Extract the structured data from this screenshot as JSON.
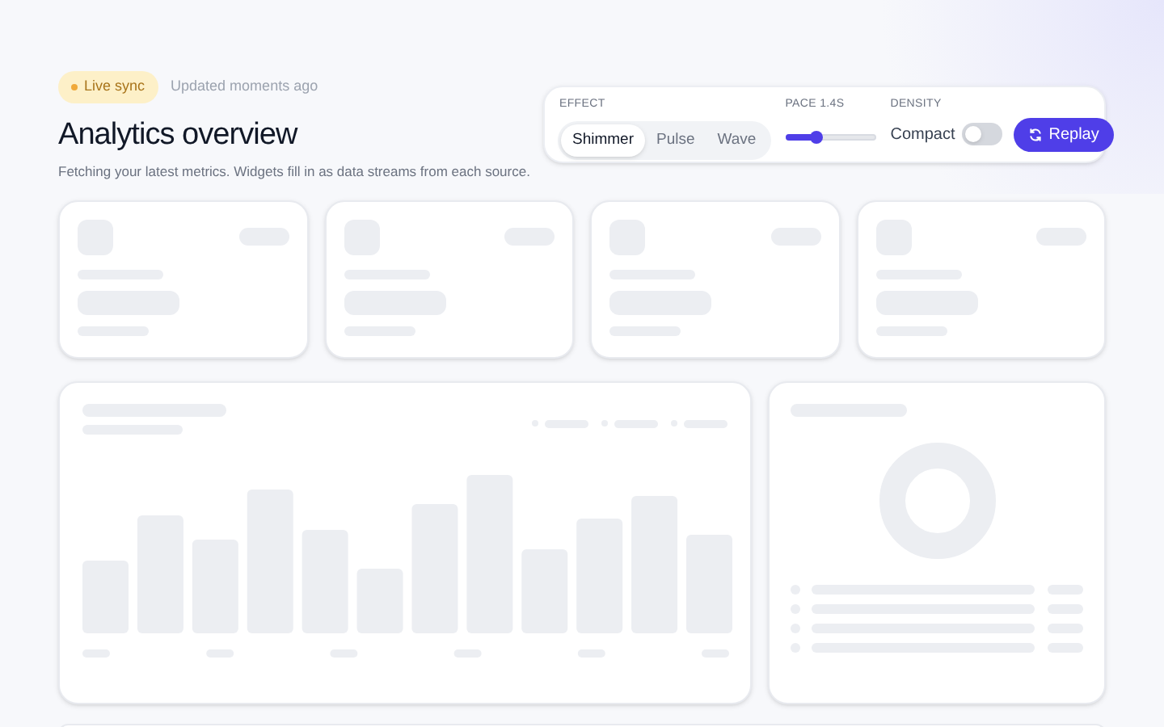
{
  "header": {
    "badge": "Live sync",
    "updated": "Updated moments ago",
    "title": "Analytics overview",
    "subtitle": "Fetching your latest metrics. Widgets fill in as data streams from each source."
  },
  "controls": {
    "effect": {
      "label": "EFFECT",
      "options": [
        {
          "label": "Shimmer",
          "selected": true
        },
        {
          "label": "Pulse",
          "selected": false
        },
        {
          "label": "Wave",
          "selected": false
        }
      ]
    },
    "pace": {
      "label": "PACE 1.4S",
      "level": 0.35
    },
    "density": {
      "label": "DENSITY",
      "option": "Compact",
      "on": false
    },
    "replay": "Replay"
  }
}
